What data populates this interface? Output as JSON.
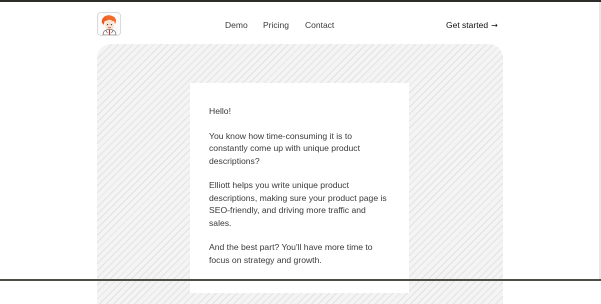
{
  "header": {
    "logo_icon": "avatar-logo-icon",
    "nav": [
      {
        "label": "Demo"
      },
      {
        "label": "Pricing"
      },
      {
        "label": "Contact"
      }
    ],
    "cta_label": "Get started",
    "cta_arrow": "→"
  },
  "card": {
    "greeting": "Hello!",
    "paragraph_1": "You know how time-consuming it is to constantly come up with unique product descriptions?",
    "paragraph_2": "Elliott helps you write unique product descriptions, making sure your product page is SEO-friendly, and driving more traffic and sales.",
    "paragraph_3": "And the best part? You'll have more time to focus on strategy and growth."
  },
  "colors": {
    "topline": "#2b2e28",
    "hero_background": "#f4f4f4",
    "hero_stripes": "#e3e3e3",
    "text": "#3a3a3a"
  }
}
